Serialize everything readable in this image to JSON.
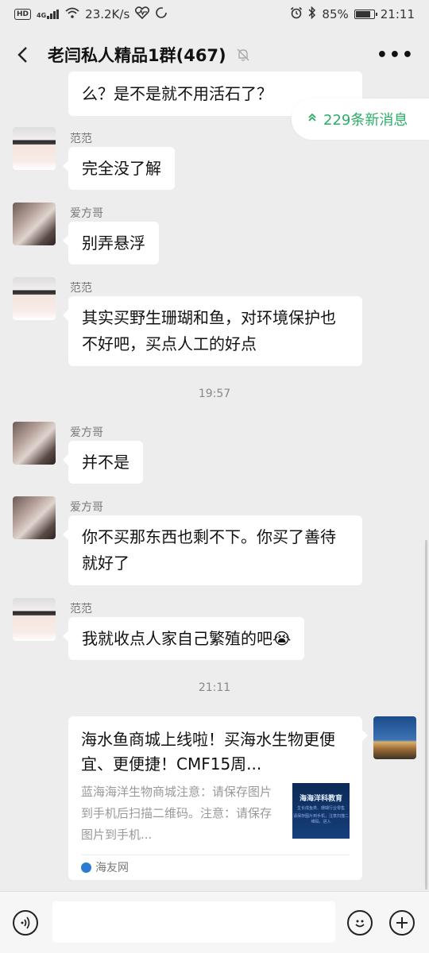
{
  "status_bar": {
    "left_badge": "HD",
    "network": "4G",
    "speed": "23.2K/s",
    "battery": "85%",
    "battery_level": 0.85,
    "time": "21:11"
  },
  "header": {
    "title": "老闫私人精品1群(467)",
    "more_label": "•••"
  },
  "new_messages": {
    "label": "229条新消息",
    "icon": "double-chevron-up-icon",
    "color": "#2aae67"
  },
  "messages": [
    {
      "type": "partial",
      "text": "么？是不是就不用活石了？"
    },
    {
      "type": "text",
      "sender": "范范",
      "avatar": "fanfan",
      "text": "完全没了解"
    },
    {
      "type": "text",
      "sender": "爱方哥",
      "avatar": "aifangge",
      "text": "别弄悬浮"
    },
    {
      "type": "text",
      "sender": "范范",
      "avatar": "fanfan",
      "text": "其实买野生珊瑚和鱼，对环境保护也不好吧，买点人工的好点"
    },
    {
      "type": "time",
      "text": "19:57"
    },
    {
      "type": "text",
      "sender": "爱方哥",
      "avatar": "aifangge",
      "text": "并不是"
    },
    {
      "type": "text",
      "sender": "爱方哥",
      "avatar": "aifangge",
      "text": "你不买那东西也剩不下。你买了善待就好了"
    },
    {
      "type": "text",
      "sender": "范范",
      "avatar": "fanfan",
      "text": "我就收点人家自己繁殖的吧",
      "emoji": "😭"
    },
    {
      "type": "time",
      "text": "21:11"
    }
  ],
  "link_card": {
    "title": "海水鱼商城上线啦！买海水生物更便宜、更便捷！CMF15周...",
    "description": "蓝海海洋生物商城注意：请保存图片到手机后扫描二维码。注意：请保存图片到手机...",
    "thumb_title": "海海洋科教育",
    "thumb_line1": "生长成鱼类、珊瑚行业零售",
    "thumb_line2": "请保存图片到手机，注意扫描二维码，进入",
    "source": "海友网"
  },
  "input": {
    "placeholder": ""
  },
  "colors": {
    "background": "#ededed",
    "bubble": "#ffffff",
    "accent_green": "#2aae67"
  }
}
